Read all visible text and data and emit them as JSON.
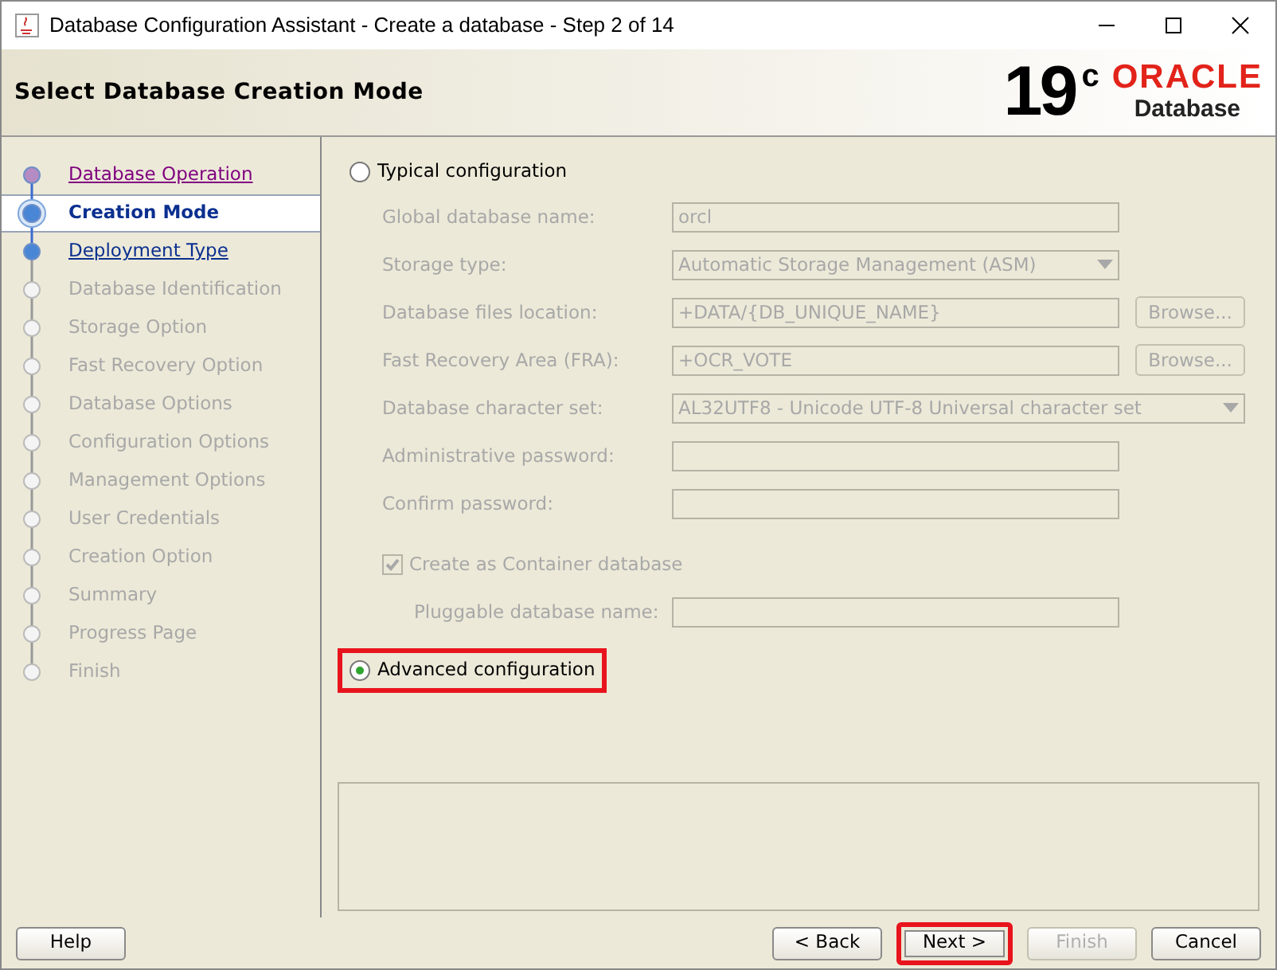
{
  "window": {
    "title": "Database Configuration Assistant - Create a database - Step 2 of 14"
  },
  "header": {
    "title": "Select Database Creation Mode",
    "version": "19",
    "version_suffix": "c",
    "brand": "ORACLE",
    "product": "Database"
  },
  "steps": [
    {
      "label": "Database Operation",
      "selected": false,
      "visited": true,
      "disabled": false
    },
    {
      "label": "Creation Mode",
      "selected": true,
      "visited": false,
      "disabled": false
    },
    {
      "label": "Deployment Type",
      "selected": false,
      "visited": false,
      "disabled": false
    },
    {
      "label": "Database Identification",
      "selected": false,
      "visited": false,
      "disabled": true
    },
    {
      "label": "Storage Option",
      "selected": false,
      "visited": false,
      "disabled": true
    },
    {
      "label": "Fast Recovery Option",
      "selected": false,
      "visited": false,
      "disabled": true
    },
    {
      "label": "Database Options",
      "selected": false,
      "visited": false,
      "disabled": true
    },
    {
      "label": "Configuration Options",
      "selected": false,
      "visited": false,
      "disabled": true
    },
    {
      "label": "Management Options",
      "selected": false,
      "visited": false,
      "disabled": true
    },
    {
      "label": "User Credentials",
      "selected": false,
      "visited": false,
      "disabled": true
    },
    {
      "label": "Creation Option",
      "selected": false,
      "visited": false,
      "disabled": true
    },
    {
      "label": "Summary",
      "selected": false,
      "visited": false,
      "disabled": true
    },
    {
      "label": "Progress Page",
      "selected": false,
      "visited": false,
      "disabled": true
    },
    {
      "label": "Finish",
      "selected": false,
      "visited": false,
      "disabled": true
    }
  ],
  "typical": {
    "label": "Typical configuration",
    "selected": false,
    "highlighted": false
  },
  "fields": [
    {
      "kind": "text",
      "label": "Global database name:",
      "value": "orcl"
    },
    {
      "kind": "select",
      "label": "Storage type:",
      "value": "Automatic Storage Management (ASM)"
    },
    {
      "kind": "browse",
      "label": "Database files location:",
      "value": "+DATA/{DB_UNIQUE_NAME}",
      "button": "Browse..."
    },
    {
      "kind": "browse",
      "label": "Fast Recovery Area (FRA):",
      "value": "+OCR_VOTE",
      "button": "Browse..."
    },
    {
      "kind": "wideselect",
      "label": "Database character set:",
      "value": "AL32UTF8 - Unicode UTF-8 Universal character set"
    },
    {
      "kind": "password",
      "label": "Administrative password:"
    },
    {
      "kind": "password",
      "label": "Confirm password:"
    }
  ],
  "container": {
    "label": "Create as Container database",
    "checked": true,
    "pdb_label": "Pluggable database name:"
  },
  "advanced": {
    "label": "Advanced configuration",
    "selected": true,
    "highlighted": true
  },
  "buttons": [
    {
      "label": "Help",
      "disabled": false,
      "highlighted": false
    },
    {
      "label": "< Back",
      "disabled": false,
      "highlighted": false
    },
    {
      "label": "Next >",
      "disabled": false,
      "highlighted": true
    },
    {
      "label": "Finish",
      "disabled": true,
      "highlighted": false
    },
    {
      "label": "Cancel",
      "disabled": false,
      "highlighted": false
    }
  ]
}
